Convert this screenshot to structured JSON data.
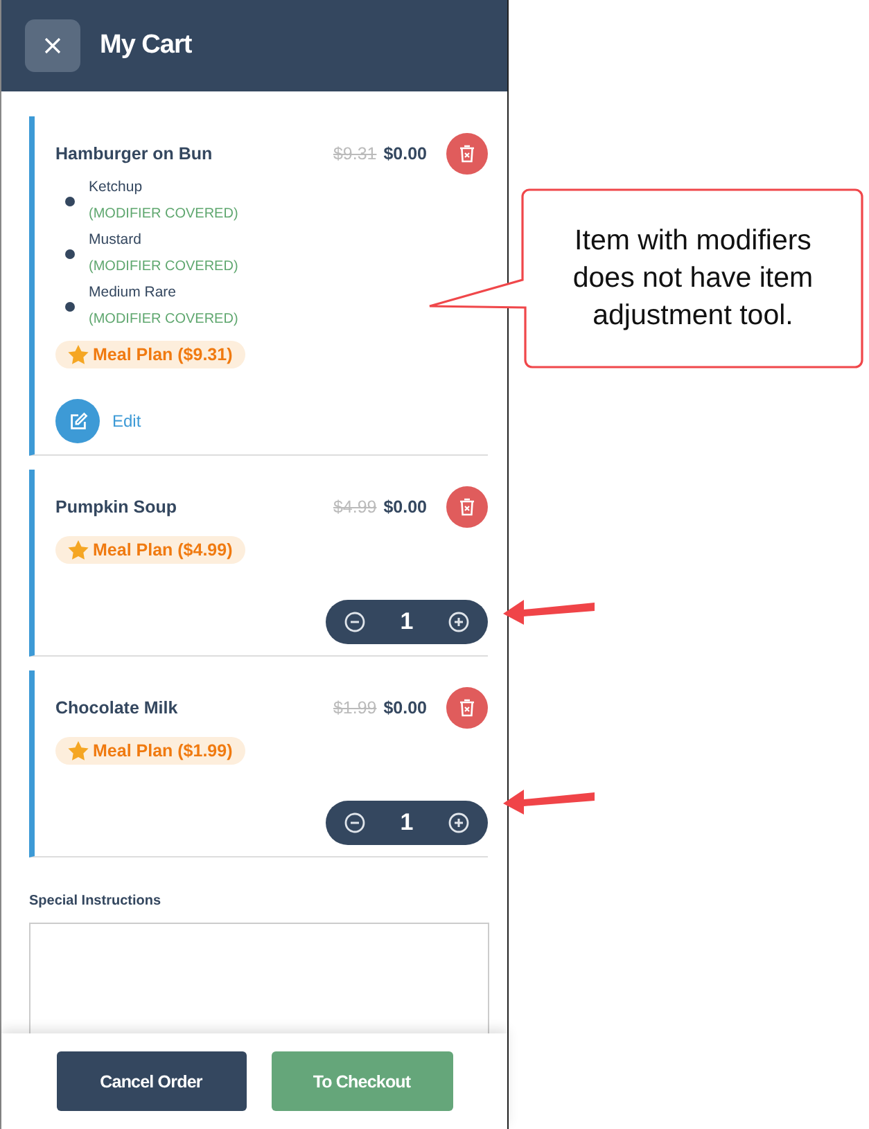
{
  "header": {
    "title": "My Cart"
  },
  "items": [
    {
      "kind": "modifiers",
      "name": "Hamburger on Bun",
      "original_price": "$9.31",
      "price": "$0.00",
      "modifiers": [
        {
          "name": "Ketchup",
          "note": "(MODIFIER COVERED)"
        },
        {
          "name": "Mustard",
          "note": "(MODIFIER COVERED)"
        },
        {
          "name": "Medium Rare",
          "note": "(MODIFIER COVERED)"
        }
      ],
      "badge": "Meal Plan ($9.31)",
      "edit_label": "Edit"
    },
    {
      "kind": "quantity",
      "name": "Pumpkin Soup",
      "original_price": "$4.99",
      "price": "$0.00",
      "badge": "Meal Plan ($4.99)",
      "quantity": "1"
    },
    {
      "kind": "quantity",
      "name": "Chocolate Milk",
      "original_price": "$1.99",
      "price": "$0.00",
      "badge": "Meal Plan ($1.99)",
      "quantity": "1"
    }
  ],
  "special_instructions": {
    "label": "Special Instructions"
  },
  "buttons": [
    {
      "label": "Cancel Order",
      "kind": "secondary"
    },
    {
      "label": "To Checkout",
      "kind": "primary"
    }
  ],
  "callout": {
    "text": "Item with modifiers does not have item adjustment tool."
  }
}
